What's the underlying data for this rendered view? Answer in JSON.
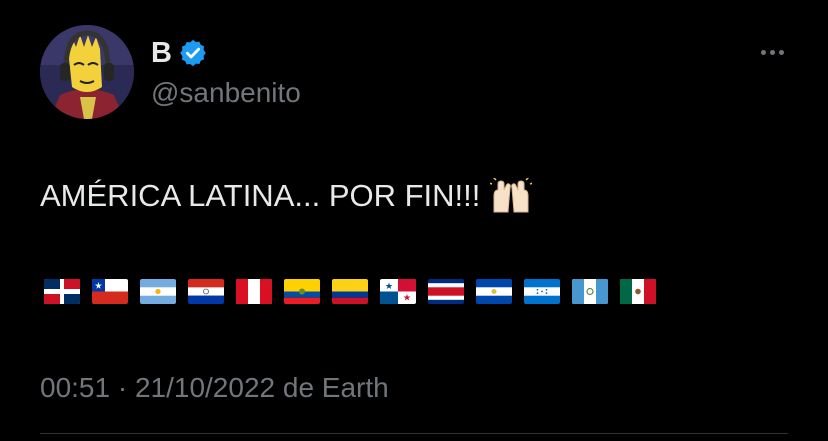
{
  "user": {
    "display_name": "B",
    "handle": "@sanbenito",
    "verified": true,
    "verified_color": "#1d9bf0"
  },
  "tweet": {
    "text": "AMÉRICA LATINA... POR FIN!!!",
    "emoji": "raising-hands",
    "flags": [
      "dominican-republic-flag",
      "chile-flag",
      "argentina-flag",
      "paraguay-flag",
      "peru-flag",
      "ecuador-flag",
      "colombia-flag",
      "panama-flag",
      "costa-rica-flag",
      "el-salvador-flag",
      "honduras-flag",
      "guatemala-flag",
      "mexico-flag"
    ]
  },
  "meta": {
    "timestamp": "00:51 · 21/10/2022 de Earth"
  },
  "colors": {
    "background": "#000000",
    "primary_text": "#e7e9ea",
    "secondary_text": "#71767b",
    "divider": "#2f3336"
  }
}
